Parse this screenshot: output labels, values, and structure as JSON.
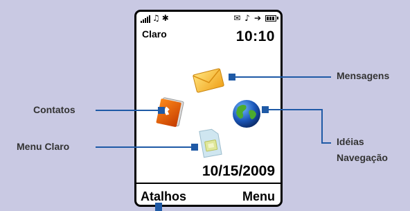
{
  "status_bar": {
    "signal_icon": "signal-strength-icon",
    "bluetooth_icon": "bluetooth-icon",
    "message_icon": "message-envelope-icon",
    "alert_icon": "ringer-bell-icon",
    "battery_icon": "battery-icon"
  },
  "carrier": "Claro",
  "time": "10:10",
  "date": "10/15/2009",
  "softkeys": {
    "left": "Atalhos",
    "right": "Menu"
  },
  "callouts": {
    "mensagens": "Mensagens",
    "contatos": "Contatos",
    "menu_claro": "Menu Claro",
    "ideias": "Idéias",
    "navegacao": "Navegação"
  },
  "colors": {
    "background": "#c9c9e3",
    "callout_line": "#1f5aa6"
  }
}
